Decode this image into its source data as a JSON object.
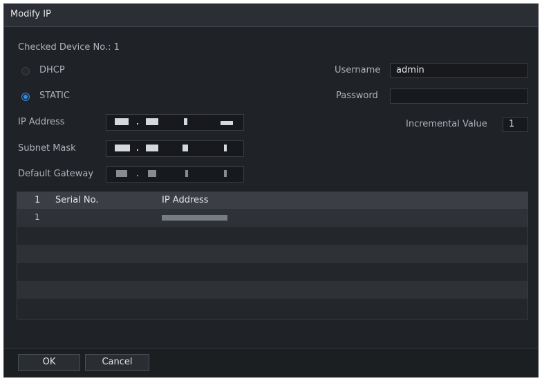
{
  "dialog": {
    "title": "Modify IP",
    "checked_device_label": "Checked Device No.: 1",
    "mode": {
      "dhcp_label": "DHCP",
      "static_label": "STATIC",
      "selected": "STATIC"
    },
    "fields": {
      "ip_address_label": "IP Address",
      "subnet_mask_label": "Subnet Mask",
      "default_gateway_label": "Default Gateway",
      "username_label": "Username",
      "username_value": "admin",
      "password_label": "Password",
      "password_value": "",
      "incremental_label": "Incremental Value",
      "incremental_value": "1"
    },
    "table": {
      "columns": [
        "1",
        "Serial No.",
        "IP Address"
      ],
      "rows": [
        {
          "index": "1",
          "serial": "",
          "ip": ""
        }
      ]
    },
    "buttons": {
      "ok": "OK",
      "cancel": "Cancel"
    }
  },
  "colors": {
    "background": "#1f2226",
    "accent": "#2f8fe6",
    "header": "#3b3f45"
  },
  "icons": [
    "radio-off-icon",
    "radio-on-icon"
  ]
}
